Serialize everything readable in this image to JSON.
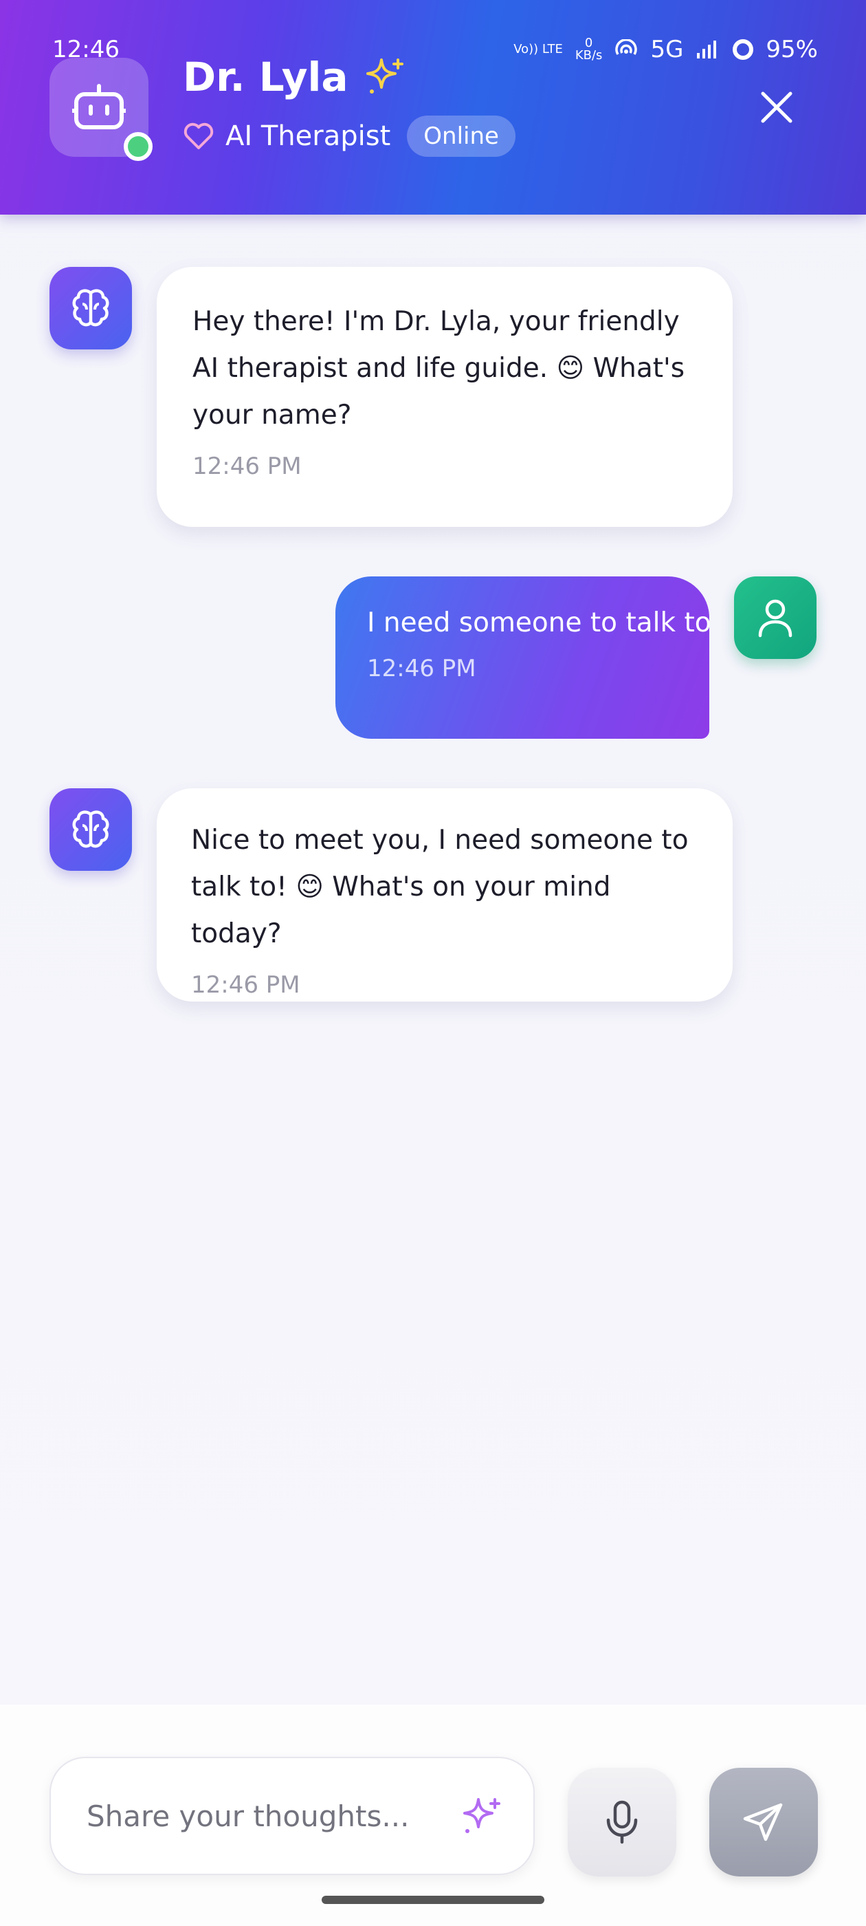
{
  "status_bar": {
    "time": "12:46",
    "volte": "Vo)) LTE",
    "speed_value": "0",
    "speed_unit": "KB/s",
    "network": "5G",
    "battery": "95%"
  },
  "header": {
    "name": "Dr. Lyla",
    "subtitle": "AI Therapist",
    "status_badge": "Online"
  },
  "messages": [
    {
      "sender": "ai",
      "text": "Hey there! I'm Dr. Lyla, your friendly AI therapist and life guide. 😊 What's your name?",
      "time": "12:46 PM"
    },
    {
      "sender": "user",
      "text": "I need someone to talk to",
      "time": "12:46 PM"
    },
    {
      "sender": "ai",
      "text": "Nice to meet you, I need someone to talk to! 😊 What's on your mind today?",
      "time": "12:46 PM"
    }
  ],
  "composer": {
    "placeholder": "Share your thoughts..."
  },
  "colors": {
    "header_start": "#8b34e6",
    "header_mid": "#2d64e8",
    "online_green": "#4cd080",
    "user_avatar": "#1fb486"
  },
  "icons": [
    "robot-icon",
    "sparkle-icon",
    "heart-icon",
    "close-icon",
    "brain-icon",
    "user-icon",
    "mic-icon",
    "send-icon"
  ]
}
